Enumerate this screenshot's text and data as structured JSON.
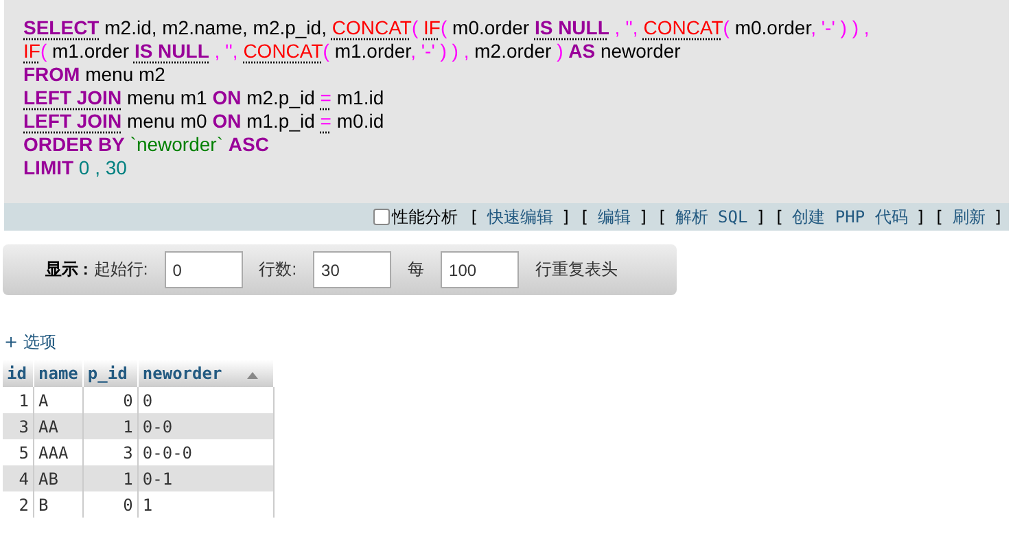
{
  "sql": {
    "lines": [
      [
        {
          "kind": "keyword-link",
          "text": "SELECT"
        },
        {
          "kind": "plain",
          "text": " m2.id, m2.name, m2.p_id, "
        },
        {
          "kind": "function-link",
          "text": "CONCAT"
        },
        {
          "kind": "punct",
          "text": "( "
        },
        {
          "kind": "function-link",
          "text": "IF"
        },
        {
          "kind": "punct",
          "text": "( "
        },
        {
          "kind": "plain",
          "text": "m0.order "
        },
        {
          "kind": "keyword-link",
          "text": "IS NULL"
        },
        {
          "kind": "punct",
          "text": " , '', "
        },
        {
          "kind": "function-link",
          "text": "CONCAT"
        },
        {
          "kind": "punct",
          "text": "( "
        },
        {
          "kind": "plain",
          "text": "m0.order"
        },
        {
          "kind": "punct",
          "text": ", '-' ) ) ,"
        }
      ],
      [
        {
          "kind": "function-link",
          "text": "IF"
        },
        {
          "kind": "punct",
          "text": "( "
        },
        {
          "kind": "plain",
          "text": "m1.order "
        },
        {
          "kind": "keyword-link",
          "text": "IS NULL"
        },
        {
          "kind": "punct",
          "text": " , '', "
        },
        {
          "kind": "function-link",
          "text": "CONCAT"
        },
        {
          "kind": "punct",
          "text": "( "
        },
        {
          "kind": "plain",
          "text": "m1.order"
        },
        {
          "kind": "punct",
          "text": ", '-' ) ) , "
        },
        {
          "kind": "plain",
          "text": "m2.order "
        },
        {
          "kind": "punct",
          "text": ") "
        },
        {
          "kind": "keyword",
          "text": "AS"
        },
        {
          "kind": "plain",
          "text": " neworder"
        }
      ],
      [
        {
          "kind": "keyword",
          "text": "FROM"
        },
        {
          "kind": "plain",
          "text": " menu m2"
        }
      ],
      [
        {
          "kind": "keyword-link",
          "text": "LEFT JOIN"
        },
        {
          "kind": "plain",
          "text": " menu m1 "
        },
        {
          "kind": "keyword",
          "text": "ON"
        },
        {
          "kind": "plain",
          "text": " m2.p_id "
        },
        {
          "kind": "operator-link",
          "text": "="
        },
        {
          "kind": "plain",
          "text": " m1.id"
        }
      ],
      [
        {
          "kind": "keyword-link",
          "text": "LEFT JOIN"
        },
        {
          "kind": "plain",
          "text": " menu m0 "
        },
        {
          "kind": "keyword",
          "text": "ON"
        },
        {
          "kind": "plain",
          "text": " m1.p_id "
        },
        {
          "kind": "operator-link",
          "text": "="
        },
        {
          "kind": "plain",
          "text": " m0.id"
        }
      ],
      [
        {
          "kind": "keyword",
          "text": "ORDER BY"
        },
        {
          "kind": "quoted",
          "text": " `neworder` "
        },
        {
          "kind": "keyword",
          "text": "ASC"
        }
      ],
      [
        {
          "kind": "keyword",
          "text": "LIMIT"
        },
        {
          "kind": "number",
          "text": " 0 , 30"
        }
      ]
    ]
  },
  "toolbar": {
    "profiling": {
      "label": "性能分析",
      "checked": false
    },
    "links": [
      {
        "open": "[",
        "label": "快速编辑",
        "close": "]"
      },
      {
        "open": "[",
        "label": "编辑",
        "close": "]"
      },
      {
        "open": "[",
        "label": "解析 SQL",
        "close": "]"
      },
      {
        "open": "[",
        "label": "创建 PHP 代码",
        "close": "]"
      },
      {
        "open": "[",
        "label": "刷新",
        "close": "]"
      }
    ]
  },
  "display": {
    "title": "显示 :",
    "start_label": "起始行:",
    "start_value": "0",
    "rows_label": "行数:",
    "rows_value": "30",
    "every_label": "每",
    "every_value": "100",
    "suffix": "行重复表头"
  },
  "options_link": "+ 选项",
  "table": {
    "columns": [
      {
        "label": "id",
        "sorted": false
      },
      {
        "label": "name",
        "sorted": false
      },
      {
        "label": "p_id",
        "sorted": false
      },
      {
        "label": "neworder",
        "sorted": true
      }
    ],
    "rows": [
      [
        "1",
        "A",
        "0",
        "0"
      ],
      [
        "3",
        "AA",
        "1",
        "0-0"
      ],
      [
        "5",
        "AAA",
        "3",
        "0-0-0"
      ],
      [
        "4",
        "AB",
        "1",
        "0-1"
      ],
      [
        "2",
        "B",
        "0",
        "1"
      ]
    ]
  }
}
